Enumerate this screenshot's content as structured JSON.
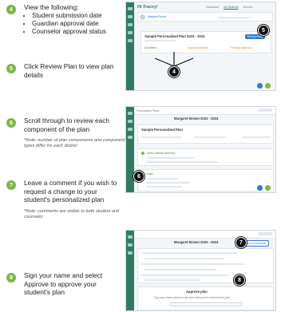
{
  "steps": [
    {
      "num": "4",
      "title": "View the following:",
      "bullets": [
        "Student submission date",
        "Guardian approval date",
        "Counselor approval status"
      ]
    },
    {
      "num": "5",
      "title": "Click Review Plan to view plan details"
    },
    {
      "num": "6",
      "title": "Scroll through to review each component of the plan",
      "note": "*Note: number of plan components and component types differ for each district"
    },
    {
      "num": "7",
      "title": "Leave a comment if you wish to request a change to your student's personalized plan",
      "note": "*Note: comments are visible to both student and counselor"
    },
    {
      "num": "8",
      "title": "Sign your name and select Approve to approve your student's plan"
    }
  ],
  "shot1": {
    "greeting": "Hi Tracey!",
    "student": "Margaret Brown",
    "tabs": [
      "Dashboard",
      "My Students",
      "Account"
    ],
    "plan_title": "Sample Personalized Plan 2023 - 2024",
    "status_left": "Submitted",
    "status_mid": "Approval pending",
    "status_right": "Pending approval",
    "review_btn": "Review Plan",
    "callouts": [
      "4",
      "5"
    ]
  },
  "shot2": {
    "header_left": "Personalized Plans",
    "student_title": "Margaret Brown 2023 - 2024",
    "subtitle": "Sample Personalized Plan",
    "section1": "Career Interest Inventory",
    "section2": "Goals",
    "callout": "6"
  },
  "shot3": {
    "student_title": "Margaret Brown 2023 - 2024",
    "link_btn": "Leave a Comment",
    "approve_title": "Approve plan",
    "approve_hint": "Sign your name below so we know that you've reviewed this plan",
    "callouts": [
      "7",
      "8"
    ]
  }
}
